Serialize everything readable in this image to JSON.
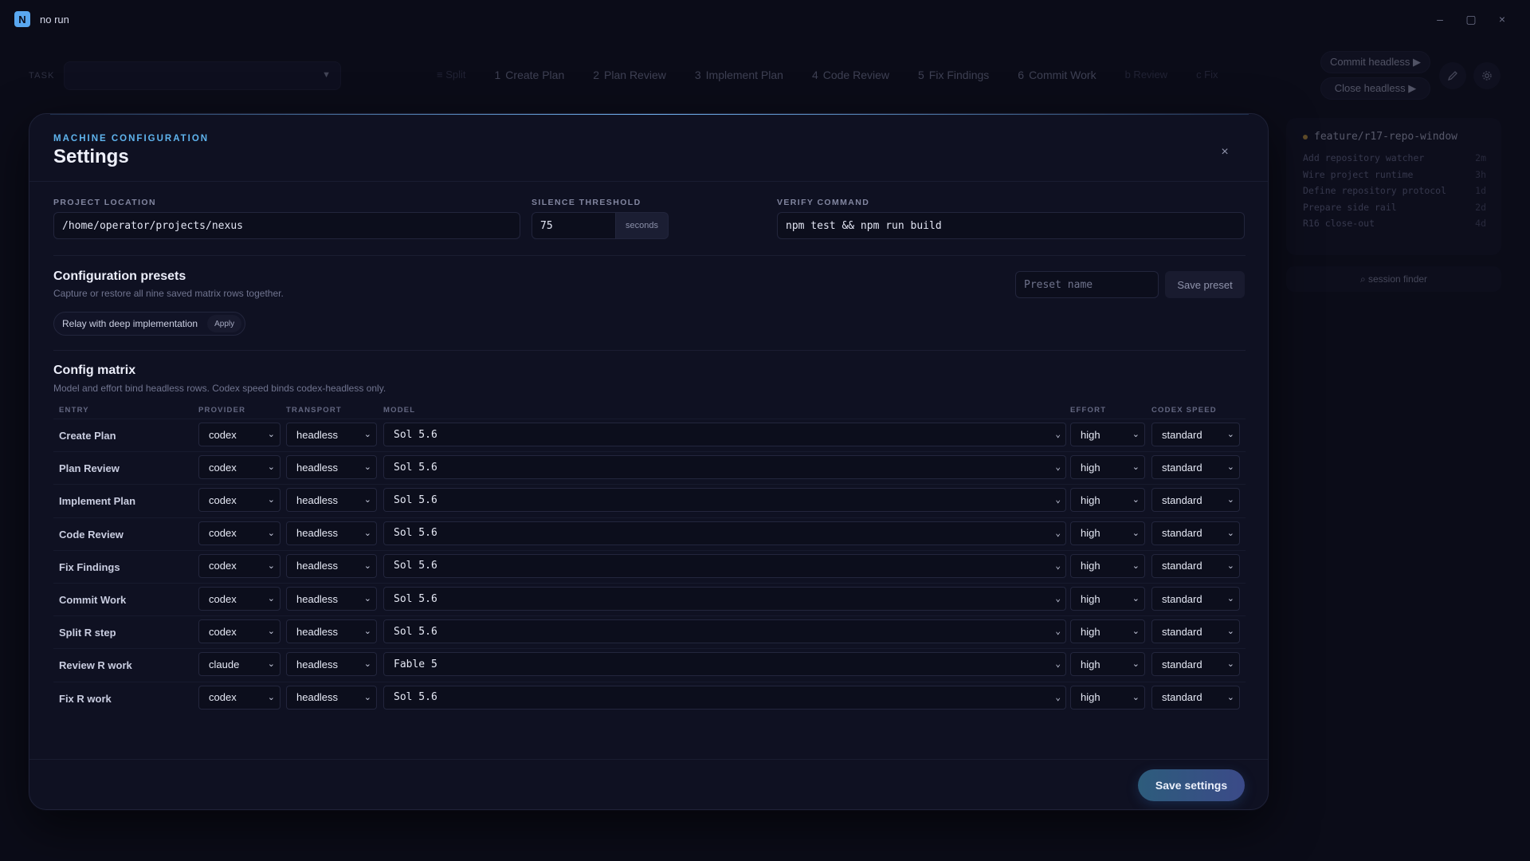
{
  "app": {
    "logo_letter": "N",
    "title": "no run"
  },
  "window_controls": {
    "minimize": "–",
    "maximize": "▢",
    "close": "×"
  },
  "topbar": {
    "task_label": "TASK",
    "steps": [
      {
        "num": "",
        "label": "≡ Split",
        "faint": true
      },
      {
        "num": "1",
        "label": "Create Plan",
        "faint": false
      },
      {
        "num": "2",
        "label": "Plan Review",
        "faint": false
      },
      {
        "num": "3",
        "label": "Implement Plan",
        "faint": false
      },
      {
        "num": "4",
        "label": "Code Review",
        "faint": false
      },
      {
        "num": "5",
        "label": "Fix Findings",
        "faint": false
      },
      {
        "num": "6",
        "label": "Commit Work",
        "faint": false
      },
      {
        "num": "",
        "label": "b Review",
        "faint": true
      },
      {
        "num": "",
        "label": "c Fix",
        "faint": true
      }
    ],
    "commit_headless": "Commit headless ▶",
    "close_headless": "Close headless ▶"
  },
  "side_panel": {
    "branch": "feature/r17-repo-window",
    "items": [
      {
        "label": "Add repository watcher",
        "age": "2m"
      },
      {
        "label": "Wire project runtime",
        "age": "3h"
      },
      {
        "label": "Define repository protocol",
        "age": "1d"
      },
      {
        "label": "Prepare side rail",
        "age": "2d"
      },
      {
        "label": "R16 close-out",
        "age": "4d"
      }
    ],
    "session_finder": "⌕ session finder"
  },
  "modal": {
    "eyebrow": "MACHINE CONFIGURATION",
    "title": "Settings",
    "close": "×",
    "project_location_label": "PROJECT LOCATION",
    "project_location_value": "/home/operator/projects/nexus",
    "silence_threshold_label": "SILENCE THRESHOLD",
    "silence_threshold_value": "75",
    "silence_threshold_unit": "seconds",
    "verify_command_label": "VERIFY COMMAND",
    "verify_command_value": "npm test && npm run build",
    "presets_title": "Configuration presets",
    "presets_sub": "Capture or restore all nine saved matrix rows together.",
    "preset_chip": "Relay with deep implementation",
    "preset_apply": "Apply",
    "preset_name_placeholder": "Preset name",
    "save_preset": "Save preset",
    "matrix_title": "Config matrix",
    "matrix_sub": "Model and effort bind headless rows. Codex speed binds codex-headless only.",
    "columns": {
      "entry": "ENTRY",
      "provider": "PROVIDER",
      "transport": "TRANSPORT",
      "model": "MODEL",
      "effort": "EFFORT",
      "codex_speed": "CODEX SPEED"
    },
    "rows": [
      {
        "entry": "Create Plan",
        "provider": "codex",
        "transport": "headless",
        "model": "Sol 5.6",
        "effort": "high",
        "speed": "standard"
      },
      {
        "entry": "Plan Review",
        "provider": "codex",
        "transport": "headless",
        "model": "Sol 5.6",
        "effort": "high",
        "speed": "standard"
      },
      {
        "entry": "Implement Plan",
        "provider": "codex",
        "transport": "headless",
        "model": "Sol 5.6",
        "effort": "high",
        "speed": "standard"
      },
      {
        "entry": "Code Review",
        "provider": "codex",
        "transport": "headless",
        "model": "Sol 5.6",
        "effort": "high",
        "speed": "standard"
      },
      {
        "entry": "Fix Findings",
        "provider": "codex",
        "transport": "headless",
        "model": "Sol 5.6",
        "effort": "high",
        "speed": "standard"
      },
      {
        "entry": "Commit Work",
        "provider": "codex",
        "transport": "headless",
        "model": "Sol 5.6",
        "effort": "high",
        "speed": "standard"
      },
      {
        "entry": "Split R step",
        "provider": "codex",
        "transport": "headless",
        "model": "Sol 5.6",
        "effort": "high",
        "speed": "standard"
      },
      {
        "entry": "Review R work",
        "provider": "claude",
        "transport": "headless",
        "model": "Fable 5",
        "effort": "high",
        "speed": "standard"
      },
      {
        "entry": "Fix R work",
        "provider": "codex",
        "transport": "headless",
        "model": "Sol 5.6",
        "effort": "high",
        "speed": "standard"
      }
    ],
    "save_settings": "Save settings"
  },
  "icons": {
    "edit": "edit-icon",
    "settings": "gear-icon",
    "chevron": "chevron-down-icon"
  },
  "colors": {
    "background": "#0b0c18",
    "accent": "#5fb4ee",
    "branch_dot": "#c79a3e"
  }
}
